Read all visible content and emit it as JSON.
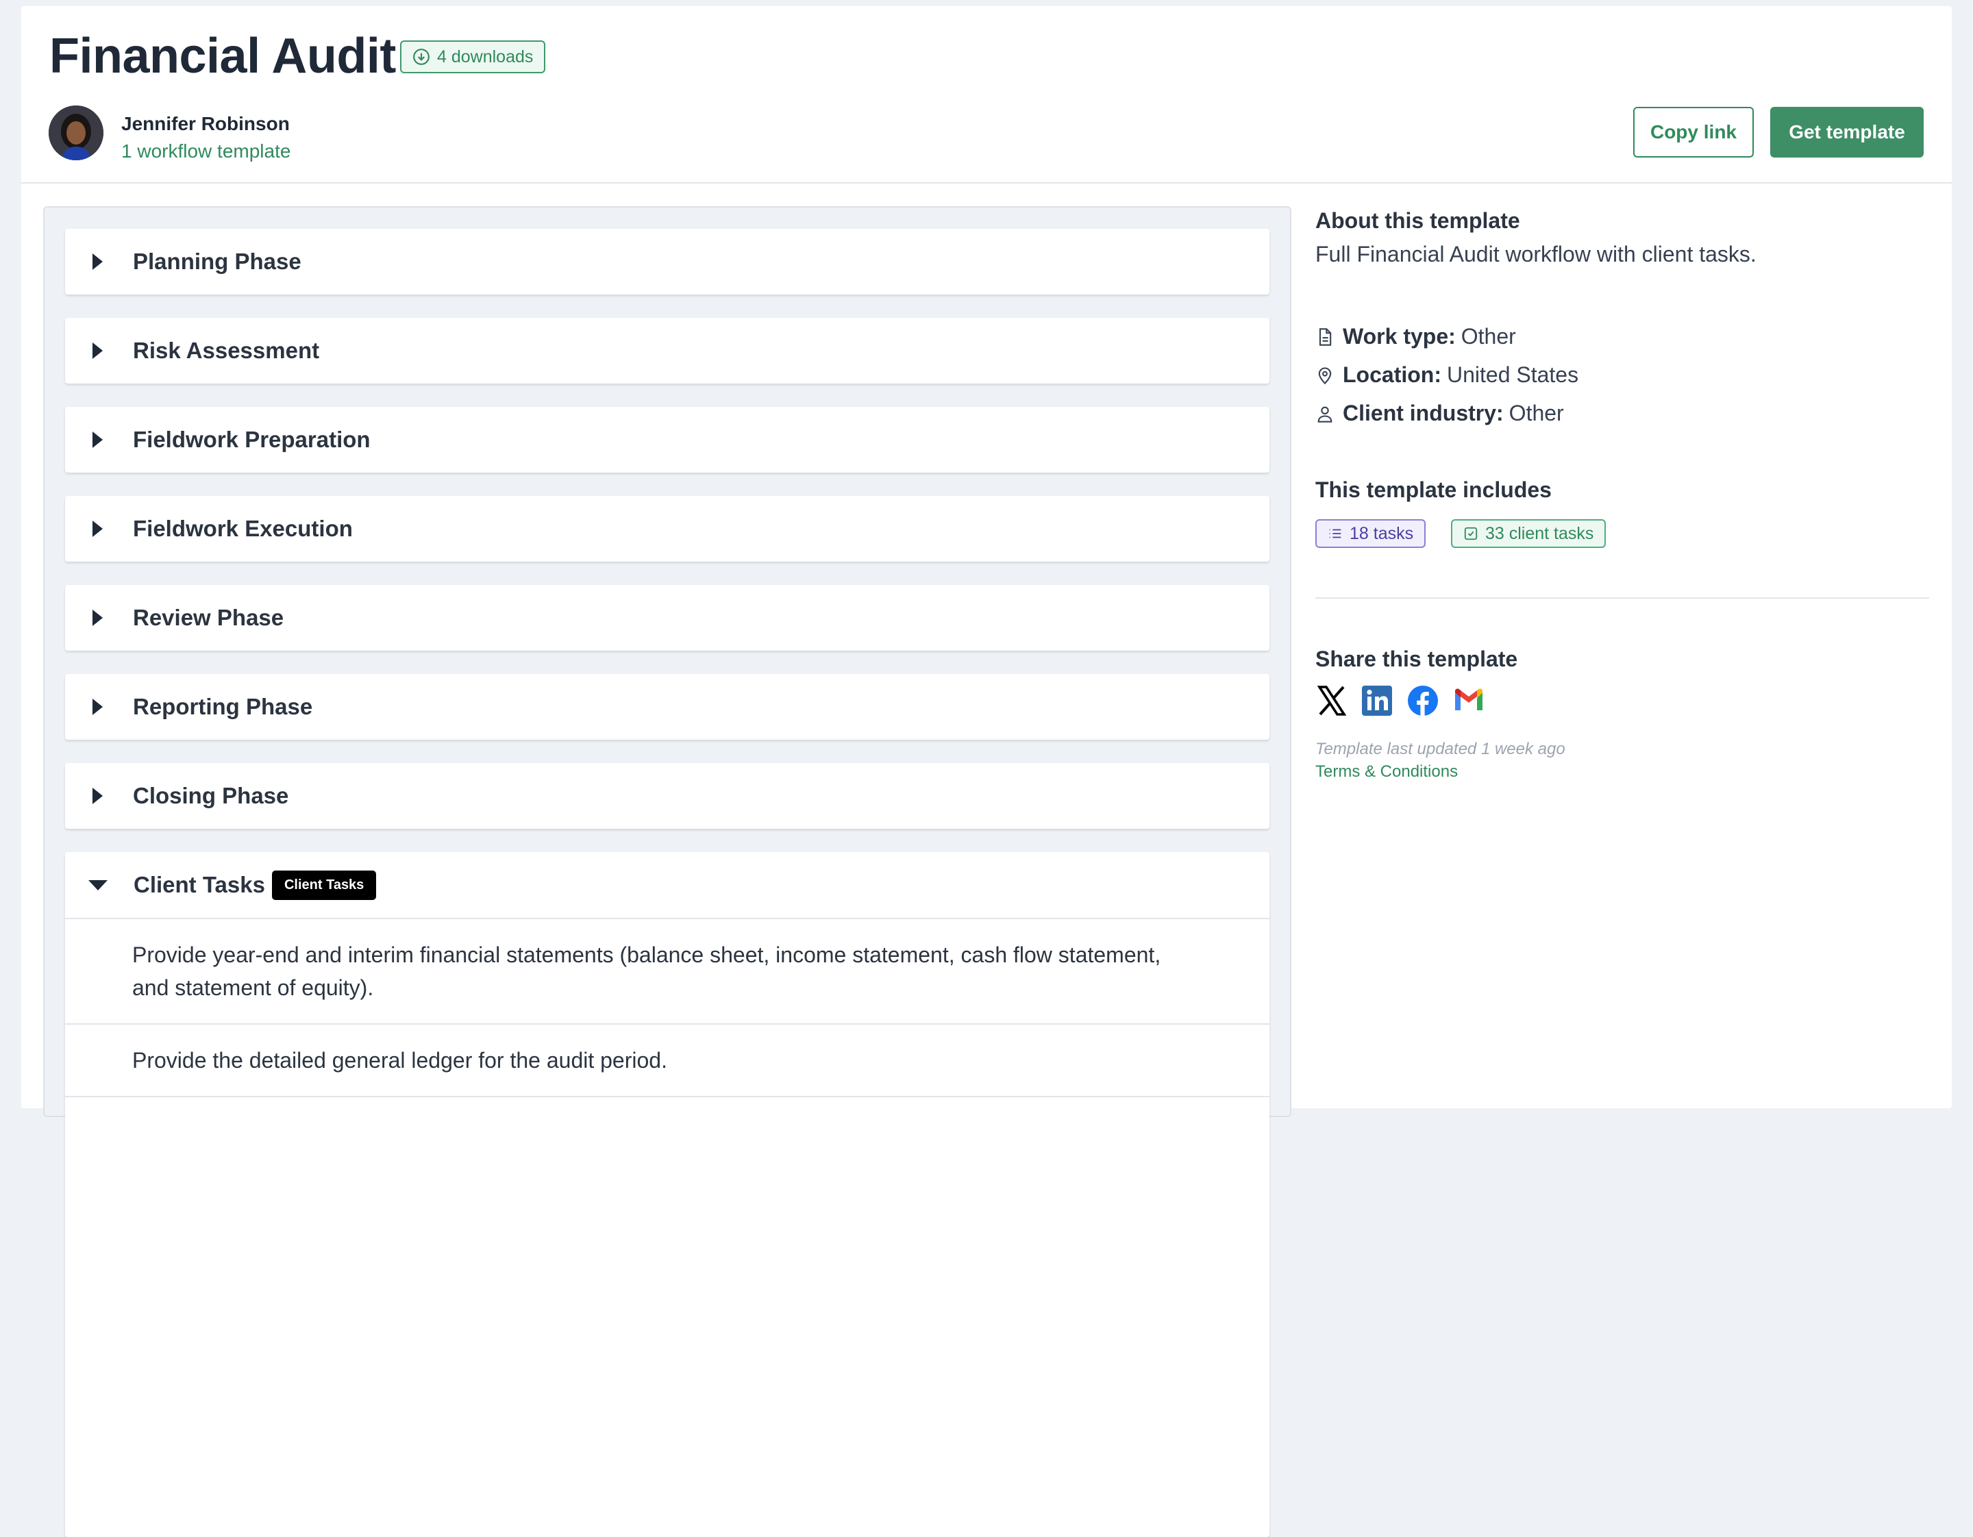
{
  "header": {
    "title": "Financial Audit",
    "downloads": "4 downloads",
    "author_name": "Jennifer Robinson",
    "author_link": "1 workflow template",
    "copy_link": "Copy link",
    "get_template": "Get template"
  },
  "sections": [
    {
      "label": "Planning Phase",
      "expanded": false
    },
    {
      "label": "Risk Assessment",
      "expanded": false
    },
    {
      "label": "Fieldwork Preparation",
      "expanded": false
    },
    {
      "label": "Fieldwork Execution",
      "expanded": false
    },
    {
      "label": "Review Phase",
      "expanded": false
    },
    {
      "label": "Reporting Phase",
      "expanded": false
    },
    {
      "label": "Closing Phase",
      "expanded": false
    },
    {
      "label": "Client Tasks",
      "expanded": true,
      "tag": "Client Tasks",
      "items": [
        "Provide year-end and interim financial statements (balance sheet, income statement, cash flow statement, and statement of equity).",
        "Provide the detailed general ledger for the audit period."
      ]
    }
  ],
  "about": {
    "title": "About this template",
    "description": "Full Financial Audit workflow with client tasks.",
    "work_type_label": "Work type:",
    "work_type_value": "Other",
    "location_label": "Location:",
    "location_value": "United States",
    "industry_label": "Client industry:",
    "industry_value": "Other"
  },
  "includes": {
    "title": "This template includes",
    "tasks": "18 tasks",
    "client_tasks": "33 client tasks"
  },
  "share": {
    "title": "Share this template",
    "icons": [
      "x-icon",
      "linkedin-icon",
      "facebook-icon",
      "gmail-icon"
    ],
    "updated": "Template last updated 1 week ago",
    "terms": "Terms & Conditions"
  },
  "colors": {
    "brand_green": "#3e8e66",
    "link_green": "#2f8a5c",
    "purple": "#4a3fa3",
    "background": "#eef1f5"
  }
}
